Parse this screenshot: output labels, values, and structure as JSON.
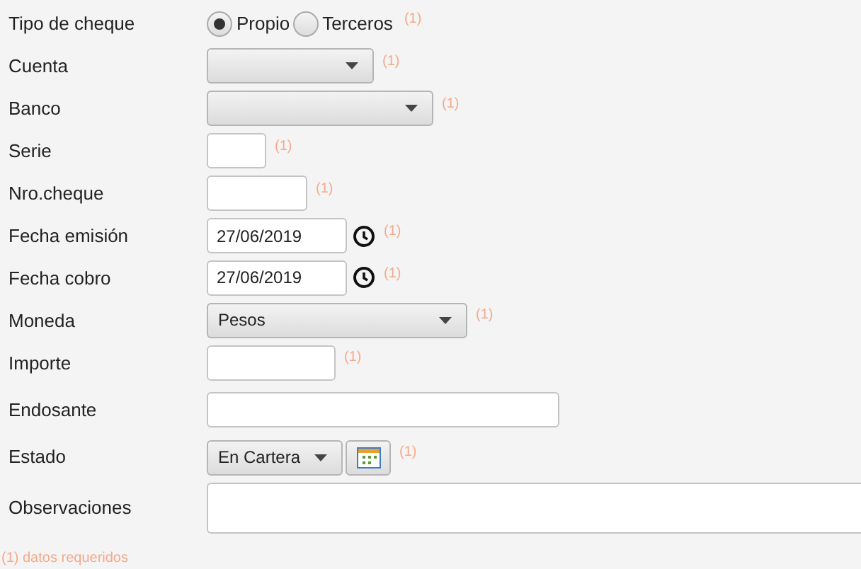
{
  "fields": [
    {
      "kind": "radio",
      "label": "Tipo de cheque",
      "options": [
        {
          "label": "Propio",
          "selected": true
        },
        {
          "label": "Terceros",
          "selected": false
        }
      ],
      "required_mark": "(1)"
    },
    {
      "kind": "select",
      "label": "Cuenta",
      "required_mark": "(1)"
    },
    {
      "kind": "select",
      "label": "Banco",
      "required_mark": "(1)"
    },
    {
      "kind": "text",
      "label": "Serie",
      "required_mark": "(1)"
    },
    {
      "kind": "text",
      "label": "Nro.cheque",
      "required_mark": "(1)"
    },
    {
      "kind": "date",
      "label": "Fecha emisión",
      "value": "27/06/2019",
      "required_mark": "(1)"
    },
    {
      "kind": "date",
      "label": "Fecha cobro",
      "value": "27/06/2019",
      "required_mark": "(1)"
    },
    {
      "kind": "select",
      "label": "Moneda",
      "value": "Pesos",
      "required_mark": "(1)"
    },
    {
      "kind": "text",
      "label": "Importe",
      "required_mark": "(1)"
    },
    {
      "kind": "text",
      "label": "Endosante"
    },
    {
      "kind": "select_button",
      "label": "Estado",
      "value": "En Cartera",
      "required_mark": "(1)"
    },
    {
      "kind": "textarea",
      "label": "Observaciones"
    }
  ],
  "footnote": "(1) datos requeridos"
}
